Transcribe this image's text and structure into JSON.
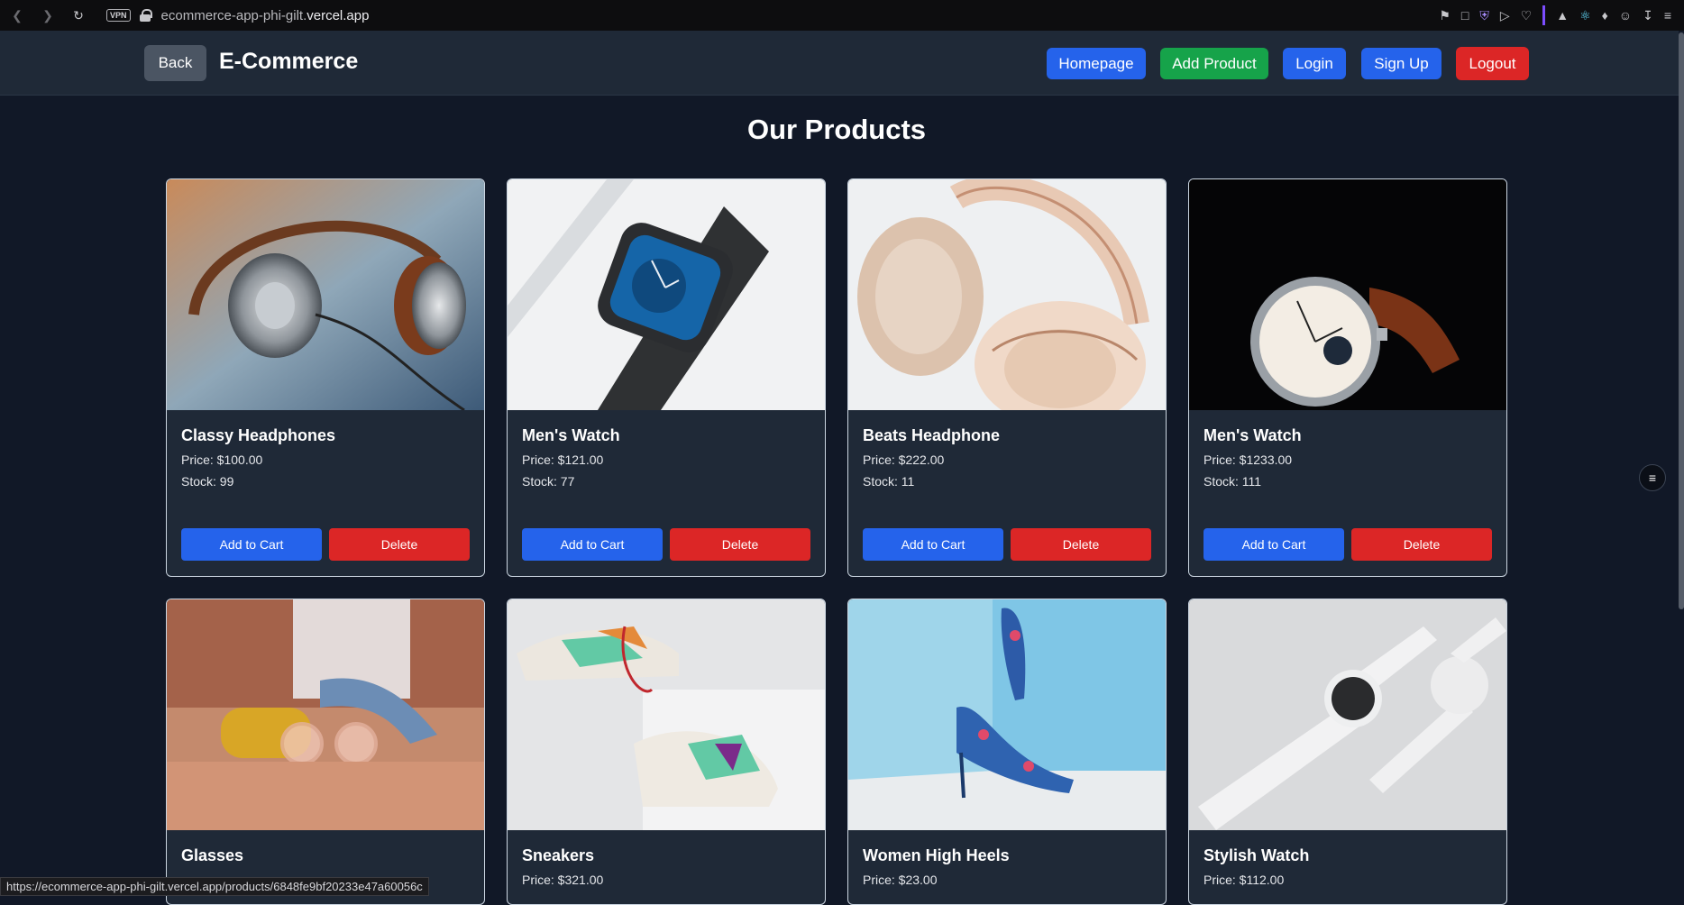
{
  "browser": {
    "url_prefix": "ecommerce-app-phi-gilt.",
    "url_domain": "vercel.app",
    "vpn_label": "VPN",
    "status_url": "https://ecommerce-app-phi-gilt.vercel.app/products/6848fe9bf20233e47a60056c"
  },
  "header": {
    "back_label": "Back",
    "brand": "E-Commerce",
    "nav": {
      "homepage": "Homepage",
      "add_product": "Add Product",
      "login": "Login",
      "signup": "Sign Up",
      "logout": "Logout"
    }
  },
  "page": {
    "title": "Our Products"
  },
  "products": [
    {
      "name": "Classy Headphones",
      "price": "Price: $100.00",
      "stock": "Stock: 99",
      "add": "Add to Cart",
      "delete": "Delete"
    },
    {
      "name": "Men's Watch",
      "price": "Price: $121.00",
      "stock": "Stock: 77",
      "add": "Add to Cart",
      "delete": "Delete"
    },
    {
      "name": "Beats Headphone",
      "price": "Price: $222.00",
      "stock": "Stock: 11",
      "add": "Add to Cart",
      "delete": "Delete"
    },
    {
      "name": "Men's Watch",
      "price": "Price: $1233.00",
      "stock": "Stock: 111",
      "add": "Add to Cart",
      "delete": "Delete"
    },
    {
      "name": "Glasses",
      "price": "",
      "stock": "",
      "add": "",
      "delete": ""
    },
    {
      "name": "Sneakers",
      "price": "Price: $321.00",
      "stock": "",
      "add": "",
      "delete": ""
    },
    {
      "name": "Women High Heels",
      "price": "Price: $23.00",
      "stock": "",
      "add": "",
      "delete": ""
    },
    {
      "name": "Stylish Watch",
      "price": "Price: $112.00",
      "stock": "",
      "add": "",
      "delete": ""
    }
  ],
  "colors": {
    "primary": "#2563eb",
    "success": "#16a34a",
    "danger": "#dc2626",
    "background": "#111827",
    "card": "#1f2937"
  }
}
